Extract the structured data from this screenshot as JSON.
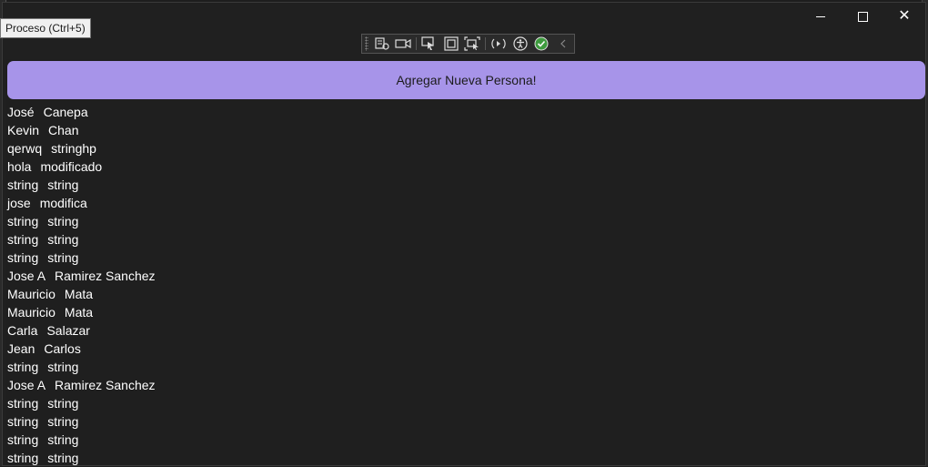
{
  "tooltip": {
    "text": "Proceso (Ctrl+5)"
  },
  "window": {
    "controls": {
      "minimize": "minimize",
      "maximize": "maximize",
      "close": "close"
    }
  },
  "devtools": {
    "icons": [
      "properties-icon",
      "camera-icon",
      "select-element-icon",
      "display-layout-icon",
      "track-focus-icon",
      "hot-reload-icon",
      "accessibility-icon",
      "ok-check-icon",
      "collapse-chevron-icon"
    ]
  },
  "add_button": {
    "label": "Agregar Nueva Persona!"
  },
  "people": [
    {
      "first": "José",
      "last": "Canepa"
    },
    {
      "first": "Kevin",
      "last": "Chan"
    },
    {
      "first": "qerwq",
      "last": "stringhp"
    },
    {
      "first": "hola",
      "last": "modificado"
    },
    {
      "first": "string",
      "last": "string"
    },
    {
      "first": "jose",
      "last": "modifica"
    },
    {
      "first": "string",
      "last": "string"
    },
    {
      "first": "string",
      "last": "string"
    },
    {
      "first": "string",
      "last": "string"
    },
    {
      "first": "Jose A",
      "last": "Ramirez Sanchez"
    },
    {
      "first": "Mauricio",
      "last": "Mata"
    },
    {
      "first": "Mauricio",
      "last": "Mata"
    },
    {
      "first": "Carla",
      "last": "Salazar"
    },
    {
      "first": "Jean",
      "last": "Carlos"
    },
    {
      "first": "string",
      "last": "string"
    },
    {
      "first": "Jose A",
      "last": "Ramirez Sanchez"
    },
    {
      "first": "string",
      "last": "string"
    },
    {
      "first": "string",
      "last": "string"
    },
    {
      "first": "string",
      "last": "string"
    },
    {
      "first": "string",
      "last": "string"
    }
  ],
  "colors": {
    "accent": "#a794e9",
    "background": "#1f1f1f",
    "text": "#ffffff"
  }
}
